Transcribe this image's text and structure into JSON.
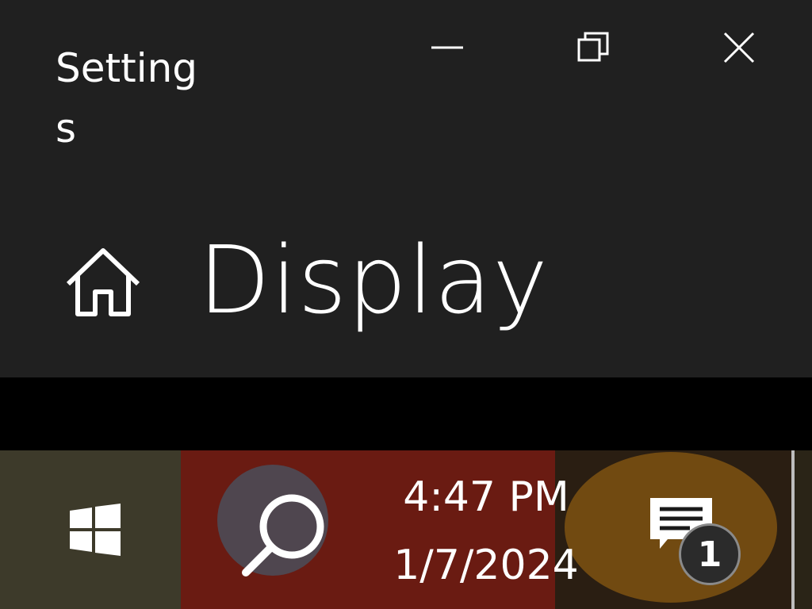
{
  "window": {
    "app_title": "Settings",
    "page_title": "Display",
    "home_icon": "home-icon",
    "caption_buttons": {
      "minimize": "minimize-icon",
      "restore": "restore-icon",
      "close": "close-icon"
    }
  },
  "taskbar": {
    "start_icon": "windows-logo-icon",
    "search_icon": "search-icon",
    "time": "4:47 PM",
    "date": "1/7/2024",
    "notifications_icon": "action-center-icon",
    "notification_count": "1"
  },
  "colors": {
    "window_bg": "#202020",
    "desktop_bg": "#000000",
    "text": "#ffffff"
  }
}
